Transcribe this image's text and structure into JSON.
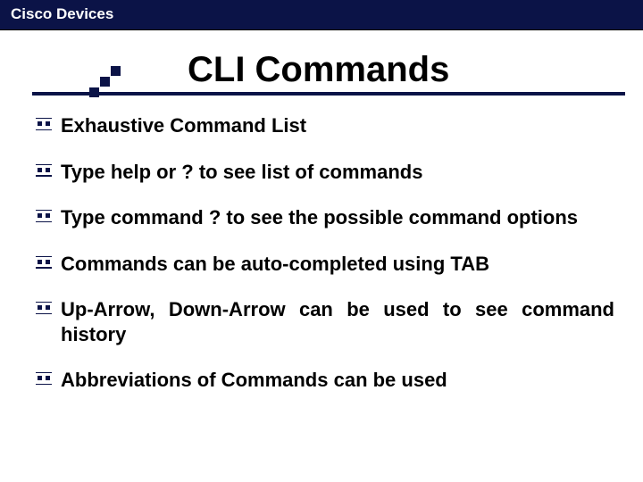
{
  "topbar": "Cisco Devices",
  "title": "CLI Commands",
  "bullets": [
    "Exhaustive Command List",
    "Type help or ? to see list of commands",
    "Type command ? to see the possible command options",
    "Commands can be auto-completed using TAB",
    "Up-Arrow, Down-Arrow can be used to see command history",
    "Abbreviations of Commands can be used"
  ]
}
